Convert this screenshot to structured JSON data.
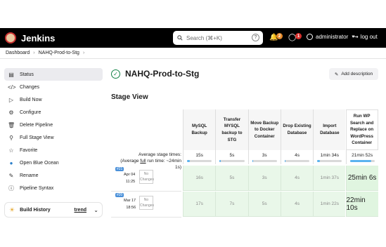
{
  "header": {
    "app_name": "Jenkins",
    "search_placeholder": "Search (⌘+K)",
    "help": "?",
    "notifications_count": "2",
    "security_count": "1",
    "user": "administrator",
    "logout": "log out"
  },
  "breadcrumb": [
    "Dashboard",
    "NAHQ-Prod-to-Stg"
  ],
  "sidebar": {
    "items": [
      {
        "label": "Status",
        "icon": "status-icon"
      },
      {
        "label": "Changes",
        "icon": "code-icon"
      },
      {
        "label": "Build Now",
        "icon": "play-icon"
      },
      {
        "label": "Configure",
        "icon": "gear-icon"
      },
      {
        "label": "Delete Pipeline",
        "icon": "trash-icon"
      },
      {
        "label": "Full Stage View",
        "icon": "search-icon"
      },
      {
        "label": "Favorite",
        "icon": "star-icon"
      },
      {
        "label": "Open Blue Ocean",
        "icon": "blue-ocean-icon"
      },
      {
        "label": "Rename",
        "icon": "pencil-icon"
      },
      {
        "label": "Pipeline Syntax",
        "icon": "help-icon"
      }
    ],
    "build_history": {
      "title": "Build History",
      "trend": "trend"
    }
  },
  "main": {
    "title": "NAHQ-Prod-to-Stg",
    "add_description": "Add description",
    "stage_view_title": "Stage View",
    "avg_label_1": "Average stage times:",
    "avg_label_2_prefix": "(Average ",
    "avg_label_2_link": "full",
    "avg_label_2_suffix": " run time: ~24min",
    "avg_label_3": "1s)",
    "stages": [
      {
        "name": "MySQL Backup",
        "avg": "15s",
        "progress": 0.1
      },
      {
        "name": "Transfer MYSQL backup to STG",
        "avg": "5s",
        "progress": 0.05
      },
      {
        "name": "Move Backup to Docker Container",
        "avg": "3s",
        "progress": 0.03
      },
      {
        "name": "Drop Existing Database",
        "avg": "4s",
        "progress": 0.04
      },
      {
        "name": "Import Database",
        "avg": "1min 34s",
        "progress": 0.12
      },
      {
        "name": "Run WP Search and Replace on WordPress Container",
        "avg": "21min 52s",
        "progress": 0.85
      }
    ],
    "builds": [
      {
        "number": "#21",
        "date": "Apr 04",
        "time": "11:25",
        "changes": "No Changes",
        "times": [
          "16s",
          "5s",
          "3s",
          "4s",
          "1min 37s",
          "25min 6s"
        ]
      },
      {
        "number": "#20",
        "date": "Mar 17",
        "time": "18:56",
        "changes": "No Changes",
        "times": [
          "17s",
          "7s",
          "5s",
          "4s",
          "1min 22s",
          "22min 10s"
        ]
      }
    ]
  }
}
